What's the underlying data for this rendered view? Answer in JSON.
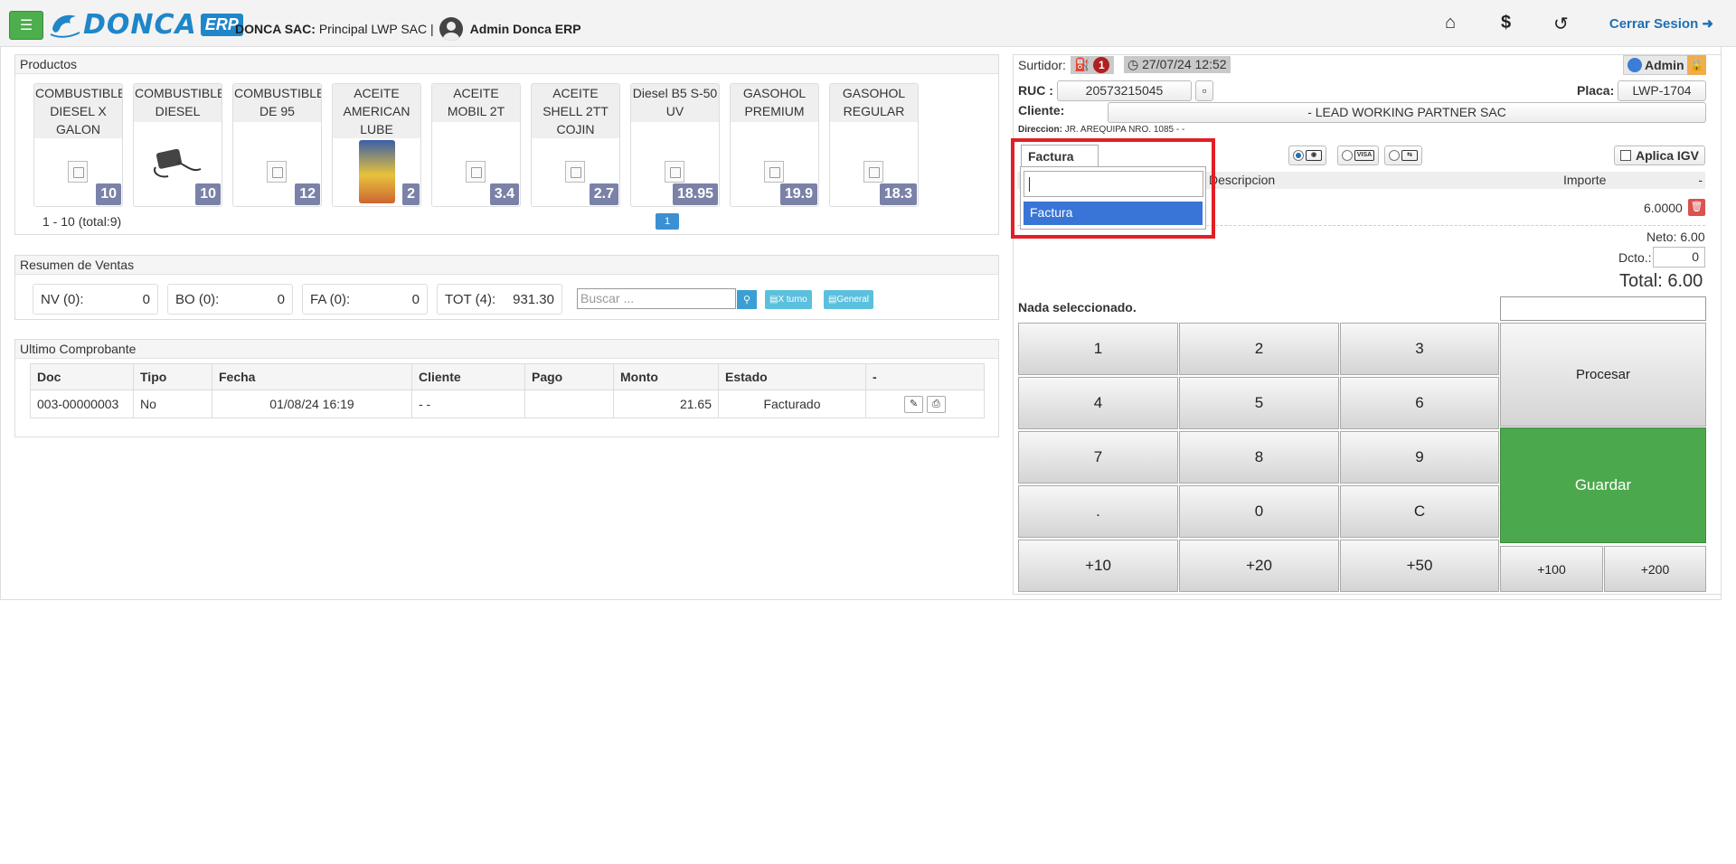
{
  "header": {
    "logo_text": "DONCA",
    "logo_badge": "ERP",
    "company_label": "DONCA SAC:",
    "company_branch": "Principal LWP SAC |",
    "user": "Admin Donca ERP",
    "logout": "Cerrar Sesion"
  },
  "productos": {
    "title": "Productos",
    "items": [
      {
        "name": "COMBUSTIBLE DIESEL X GALON",
        "price": "10"
      },
      {
        "name": "COMBUSTIBLE DIESEL",
        "price": "10"
      },
      {
        "name": "COMBUSTIBLE DE 95",
        "price": "12"
      },
      {
        "name": "ACEITE AMERICAN LUBE",
        "price": "2"
      },
      {
        "name": "ACEITE MOBIL 2T",
        "price": "3.4"
      },
      {
        "name": "ACEITE SHELL 2TT COJIN",
        "price": "2.7"
      },
      {
        "name": "Diesel B5 S-50 UV",
        "price": "18.95"
      },
      {
        "name": "GASOHOL PREMIUM",
        "price": "19.9"
      },
      {
        "name": "GASOHOL REGULAR",
        "price": "18.3"
      }
    ],
    "range": "1 - 10 (total:9)",
    "page": "1"
  },
  "resumen": {
    "title": "Resumen de Ventas",
    "boxes": [
      {
        "label": "NV (0):",
        "value": "0"
      },
      {
        "label": "BO (0):",
        "value": "0"
      },
      {
        "label": "FA (0):",
        "value": "0"
      },
      {
        "label": "TOT (4):",
        "value": "931.30"
      }
    ],
    "search_placeholder": "Buscar ...",
    "btn_turno": "X turno",
    "btn_general": "General"
  },
  "ultimo": {
    "title": "Ultimo Comprobante",
    "columns": [
      "Doc",
      "Tipo",
      "Fecha",
      "Cliente",
      "Pago",
      "Monto",
      "Estado",
      "-"
    ],
    "row": {
      "doc": "003-00000003",
      "tipo": "No",
      "fecha": "01/08/24 16:19",
      "cliente": "- -",
      "pago": "",
      "monto": "21.65",
      "estado": "Facturado"
    }
  },
  "venta": {
    "surtidor_label": "Surtidor:",
    "surtidor_num": "1",
    "datetime": "27/07/24 12:52",
    "admin": "Admin",
    "ruc_label": "RUC :",
    "ruc": "20573215045",
    "placa_label": "Placa:",
    "placa": "LWP-1704",
    "cliente_label": "Cliente:",
    "cliente": "- LEAD WORKING PARTNER SAC",
    "direccion_label": "Direccion:",
    "direccion": "JR. AREQUIPA NRO. 1085 - -",
    "doc_type": "Factura",
    "doc_option": "Factura",
    "aplica_igv": "Aplica IGV",
    "col_descripcion": "Descripcion",
    "col_importe": "Importe",
    "col_dash": "-",
    "item_importe": "6.0000",
    "neto": "Neto: 6.00",
    "dcto_label": "Dcto.:",
    "dcto": "0",
    "total": "Total: 6.00",
    "nada": "Nada seleccionado."
  },
  "keypad": {
    "keys": [
      "1",
      "2",
      "3",
      "4",
      "5",
      "6",
      "7",
      "8",
      "9",
      ".",
      "0",
      "C",
      "+10",
      "+20",
      "+50"
    ],
    "procesar": "Procesar",
    "guardar": "Guardar",
    "plus100": "+100",
    "plus200": "+200"
  }
}
